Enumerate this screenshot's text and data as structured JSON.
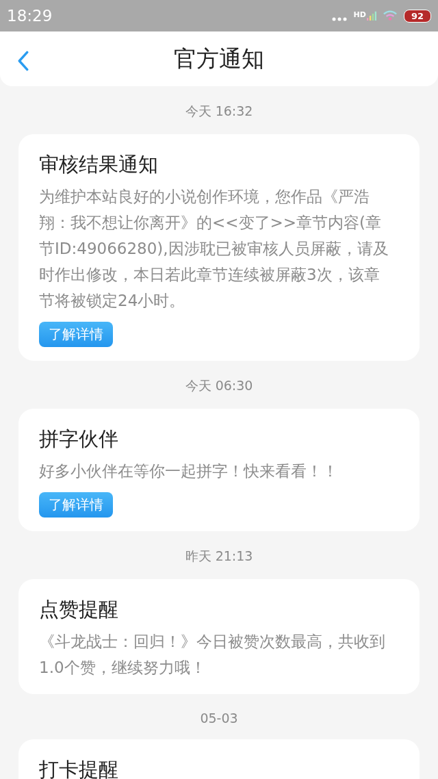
{
  "status_bar": {
    "time": "18:29",
    "network": "HD",
    "battery": "92"
  },
  "header": {
    "title": "官方通知"
  },
  "messages": [
    {
      "time": "今天 16:32",
      "title": "审核结果通知",
      "body": "为维护本站良好的小说创作环境，您作品《严浩翔：我不想让你离开》的<<变了>>章节内容(章节ID:49066280),因涉耽已被审核人员屏蔽，请及时作出修改，本日若此章节连续被屏蔽3次，该章节将被锁定24小时。",
      "button": "了解详情"
    },
    {
      "time": "今天 06:30",
      "title": "拼字伙伴",
      "body": "好多小伙伴在等你一起拼字！快来看看！！",
      "button": "了解详情"
    },
    {
      "time": "昨天 21:13",
      "title": "点赞提醒",
      "body": "《斗龙战士：回归！》今日被赞次数最高，共收到1.0个赞，继续努力哦！"
    },
    {
      "time": "05-03",
      "title": "打卡提醒"
    }
  ]
}
